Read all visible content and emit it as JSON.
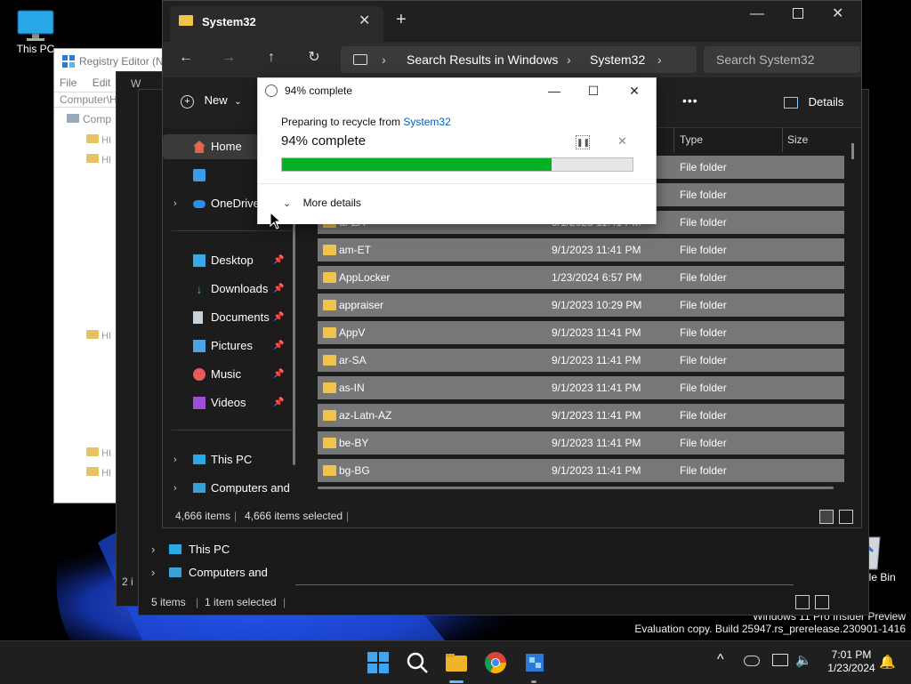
{
  "desktop": {
    "icons": [
      {
        "name": "this-pc",
        "label": "This PC"
      },
      {
        "name": "recycle-bin",
        "label": "Recycle Bin"
      }
    ],
    "watermark_line1": "Windows 11 Pro Insider Preview",
    "watermark_line2": "Evaluation copy. Build 25947.rs_prerelease.230901-1416"
  },
  "regedit": {
    "title": "Registry Editor (N",
    "menu": [
      "File",
      "Edit"
    ],
    "address": "Computer\\H",
    "tree_root": "Comp",
    "tree_items": [
      "HI",
      "HI",
      "HI",
      "HI",
      "HI"
    ]
  },
  "back_window": {
    "w_label": "W",
    "nav": [
      "This PC",
      "Computers and"
    ],
    "status_items": "5 items",
    "status_selected": "1 item selected",
    "partial_count": "2 i"
  },
  "explorer": {
    "tab_title": "System32",
    "breadcrumbs": [
      "Search Results in Windows",
      "System32"
    ],
    "search_placeholder": "Search System32",
    "new_label": "New",
    "details_label": "Details",
    "more_label": "•••",
    "sidebar": {
      "home": "Home",
      "onedrive": "OneDrive",
      "pinned": [
        "Desktop",
        "Downloads",
        "Documents",
        "Pictures",
        "Music",
        "Videos"
      ],
      "this_pc": "This PC",
      "network": "Computers and"
    },
    "columns": {
      "type": "Type",
      "size": "Size"
    },
    "rows": [
      {
        "name": "",
        "date": "",
        "type": "File folder"
      },
      {
        "name": "",
        "date": "",
        "type": "File folder"
      },
      {
        "name": "af-ZA",
        "date": "9/1/2023 11:41 PM",
        "type": "File folder"
      },
      {
        "name": "am-ET",
        "date": "9/1/2023 11:41 PM",
        "type": "File folder"
      },
      {
        "name": "AppLocker",
        "date": "1/23/2024 6:57 PM",
        "type": "File folder"
      },
      {
        "name": "appraiser",
        "date": "9/1/2023 10:29 PM",
        "type": "File folder"
      },
      {
        "name": "AppV",
        "date": "9/1/2023 11:41 PM",
        "type": "File folder"
      },
      {
        "name": "ar-SA",
        "date": "9/1/2023 11:41 PM",
        "type": "File folder"
      },
      {
        "name": "as-IN",
        "date": "9/1/2023 11:41 PM",
        "type": "File folder"
      },
      {
        "name": "az-Latn-AZ",
        "date": "9/1/2023 11:41 PM",
        "type": "File folder"
      },
      {
        "name": "be-BY",
        "date": "9/1/2023 11:41 PM",
        "type": "File folder"
      },
      {
        "name": "bg-BG",
        "date": "9/1/2023 11:41 PM",
        "type": "File folder"
      }
    ],
    "status_items": "4,666 items",
    "status_selected": "4,666 items selected"
  },
  "dialog": {
    "title": "94% complete",
    "subtitle_prefix": "Preparing to recycle from ",
    "subtitle_link": "System32",
    "percent_text": "94% complete",
    "progress_fraction": 0.77,
    "more_details": "More details",
    "colors": {
      "progress": "#06b025"
    }
  },
  "taskbar": {
    "time": "7:01 PM",
    "date": "1/23/2024",
    "apps": [
      "windows-start-icon",
      "search-icon",
      "file-explorer-icon",
      "chrome-icon",
      "app-icon"
    ]
  }
}
